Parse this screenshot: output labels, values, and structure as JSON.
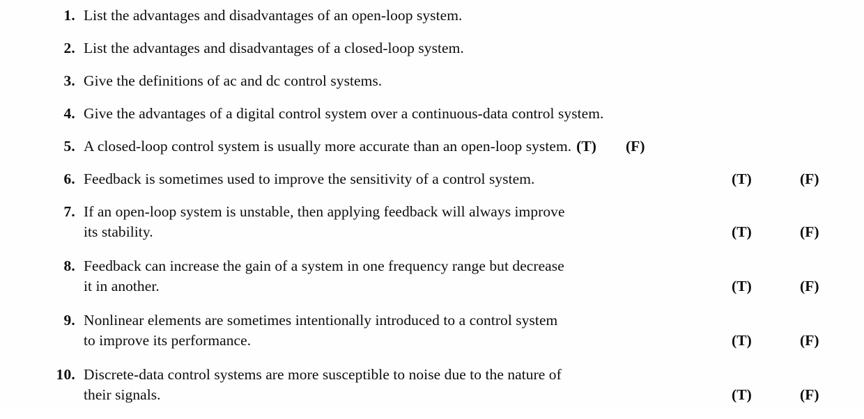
{
  "page": {
    "background_color": "#fefefe",
    "text_color": "#0d0d0d",
    "true_label": "(T)",
    "false_label": "(F)"
  },
  "questions": [
    {
      "number": "1.",
      "lines": [
        "List the advantages and disadvantages of an open-loop system."
      ],
      "true_false": false,
      "tf_placement": "none"
    },
    {
      "number": "2.",
      "lines": [
        "List the advantages and disadvantages of a closed-loop system."
      ],
      "true_false": false,
      "tf_placement": "none"
    },
    {
      "number": "3.",
      "lines": [
        "Give the definitions of ac and dc control systems."
      ],
      "true_false": false,
      "tf_placement": "none"
    },
    {
      "number": "4.",
      "lines": [
        "Give the advantages of a digital control system over a continuous-data control system."
      ],
      "true_false": false,
      "tf_placement": "none"
    },
    {
      "number": "5.",
      "lines": [
        "A closed-loop control system is usually more accurate than an open-loop system."
      ],
      "true_false": true,
      "tf_placement": "inline"
    },
    {
      "number": "6.",
      "lines": [
        "Feedback is sometimes used to improve the sensitivity of a control system."
      ],
      "true_false": true,
      "tf_placement": "aligned"
    },
    {
      "number": "7.",
      "lines": [
        "If an open-loop system is unstable, then applying feedback will always improve",
        "its stability."
      ],
      "true_false": true,
      "tf_placement": "second-line"
    },
    {
      "number": "8.",
      "lines": [
        "Feedback can increase the gain of a system in one frequency range but decrease",
        "it in another."
      ],
      "true_false": true,
      "tf_placement": "second-line"
    },
    {
      "number": "9.",
      "lines": [
        "Nonlinear elements are sometimes intentionally introduced to a control system",
        "to improve its performance."
      ],
      "true_false": true,
      "tf_placement": "second-line"
    },
    {
      "number": "10.",
      "lines": [
        "Discrete-data control systems are more susceptible to noise due to the nature of",
        "their signals."
      ],
      "true_false": true,
      "tf_placement": "second-line"
    }
  ]
}
